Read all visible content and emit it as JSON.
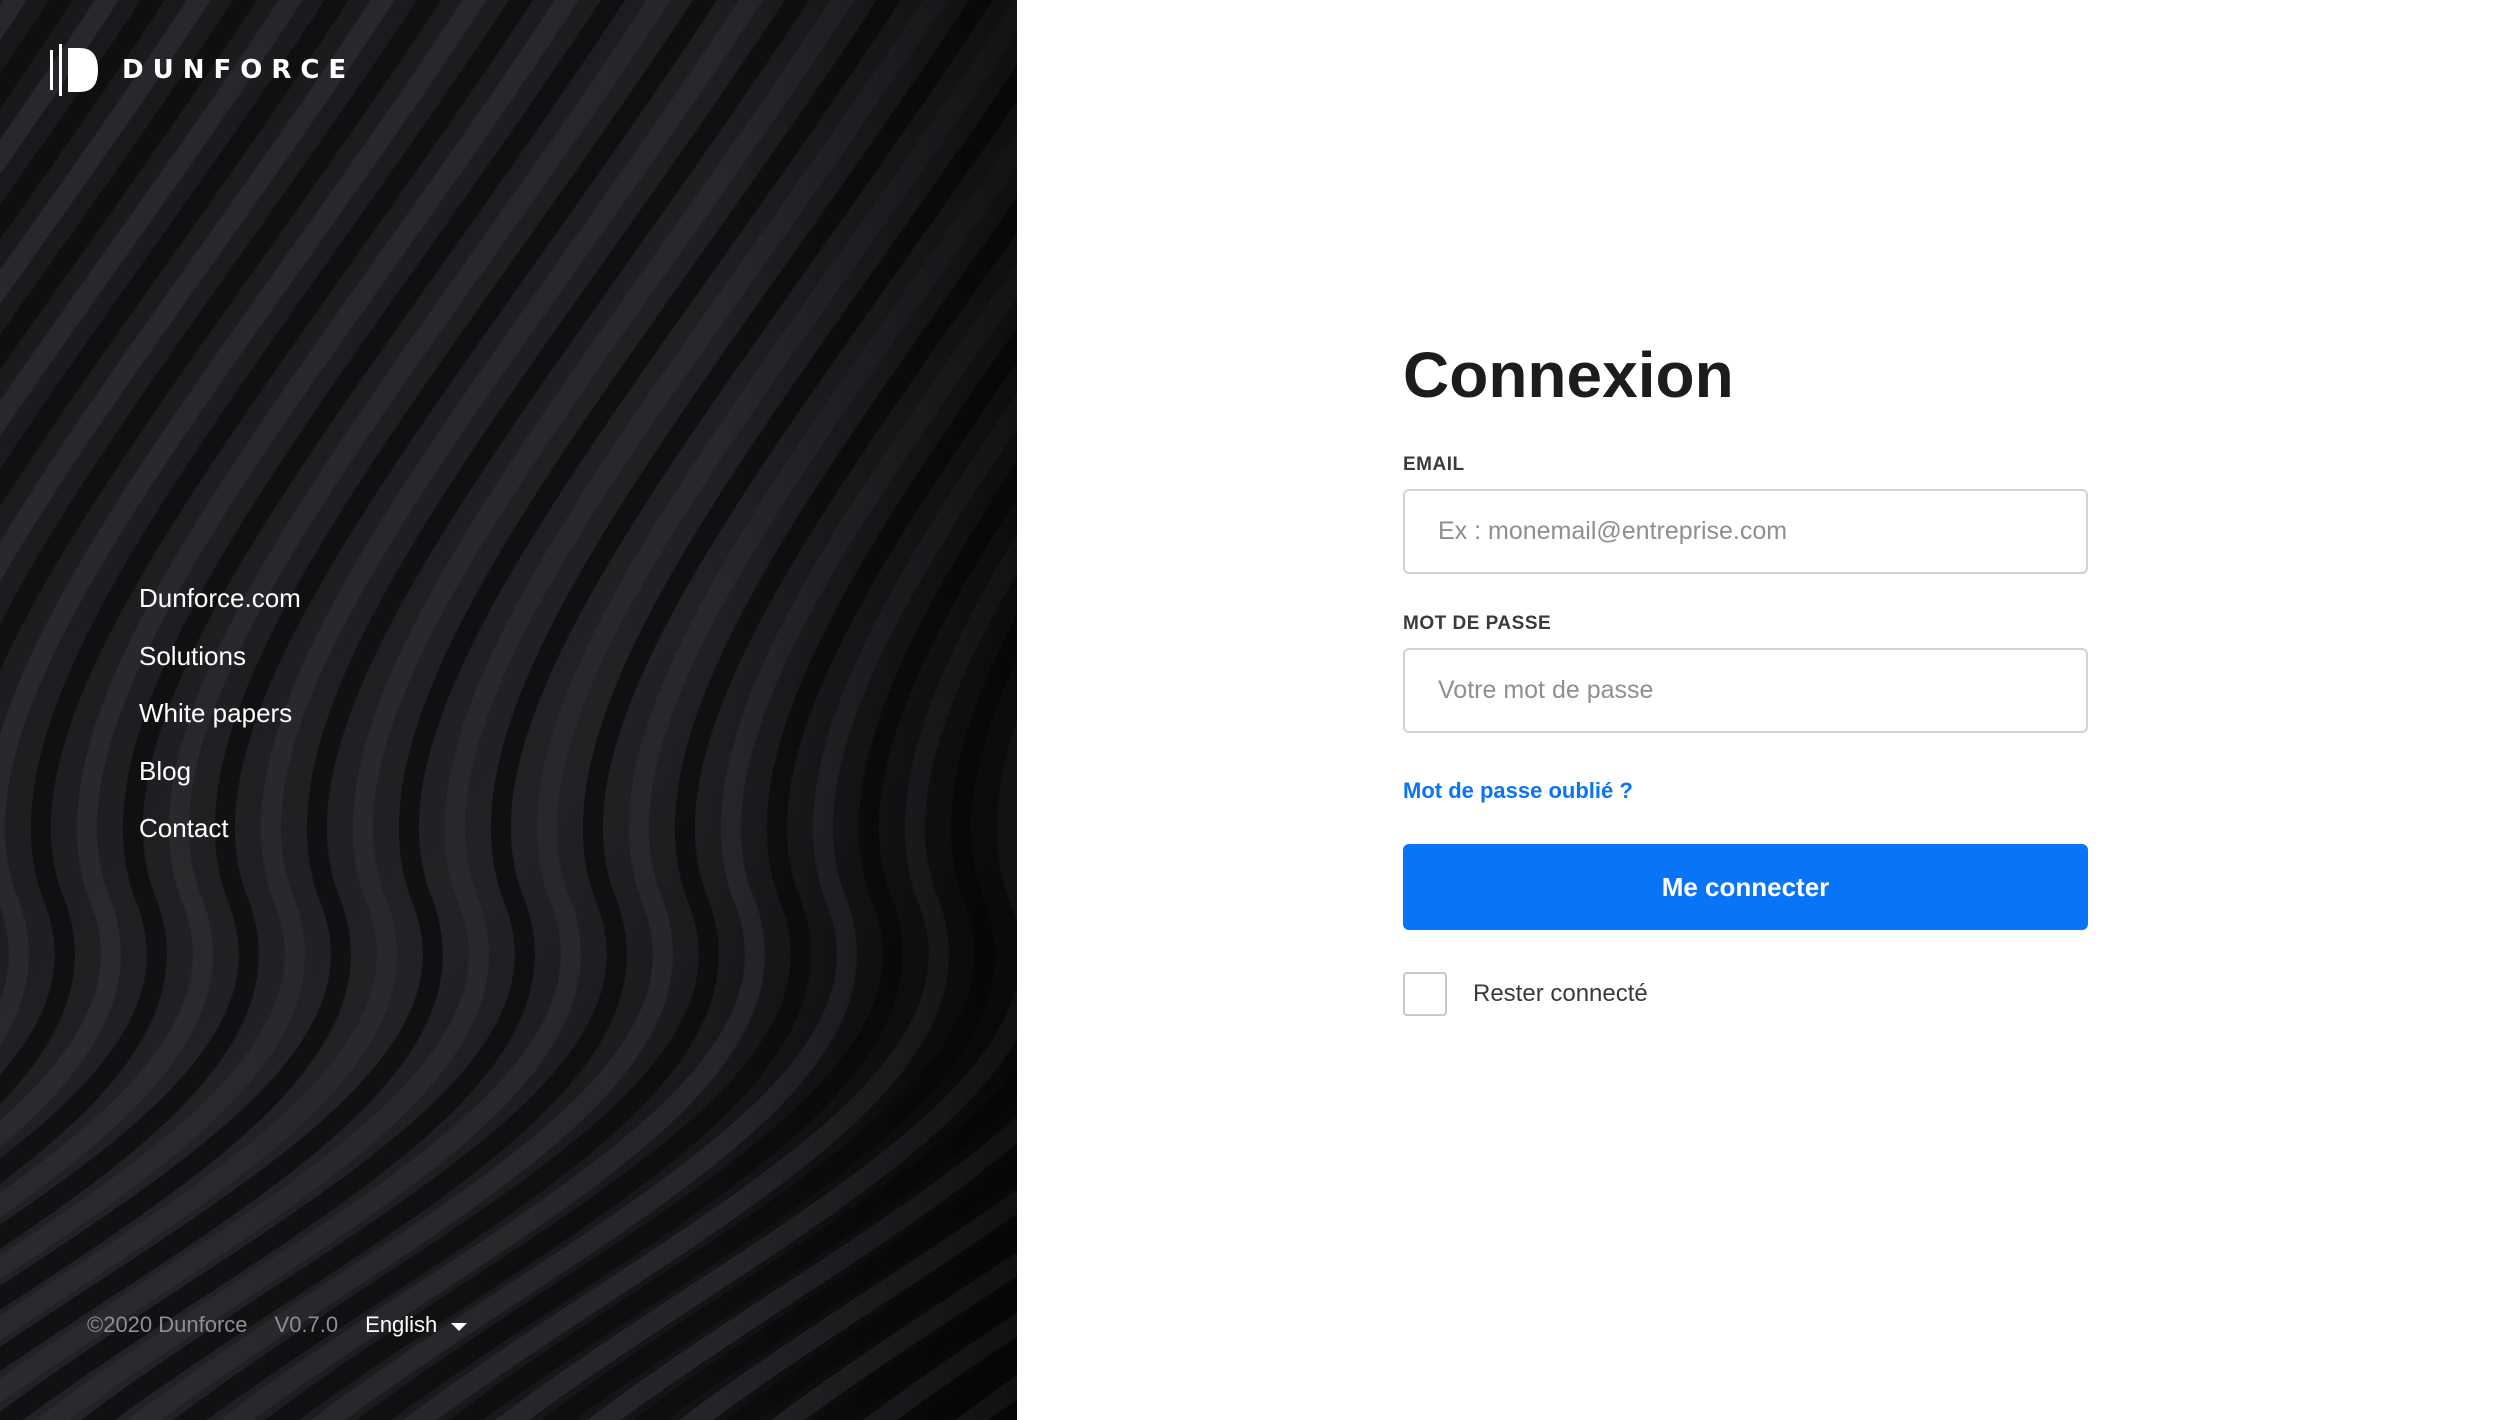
{
  "brand": {
    "name": "DUNFORCE"
  },
  "side_nav": {
    "items": [
      {
        "label": "Dunforce.com"
      },
      {
        "label": "Solutions"
      },
      {
        "label": "White papers"
      },
      {
        "label": "Blog"
      },
      {
        "label": "Contact"
      }
    ]
  },
  "footer": {
    "copyright": "©2020 Dunforce",
    "version": "V0.7.0",
    "language": "English"
  },
  "login": {
    "title": "Connexion",
    "email_label": "EMAIL",
    "email_placeholder": "Ex : monemail@entreprise.com",
    "email_value": "",
    "password_label": "MOT DE PASSE",
    "password_placeholder": "Votre mot de passe",
    "password_value": "",
    "forgot_link": "Mot de passe oublié ?",
    "submit_label": "Me connecter",
    "remember_label": "Rester connecté",
    "remember_checked": false
  },
  "colors": {
    "accent": "#0a74f6",
    "panel_bg": "#111214",
    "title": "#1c1c1e"
  },
  "icons": {
    "logo": "dunforce-logo-icon",
    "language_caret": "caret-down-icon"
  }
}
